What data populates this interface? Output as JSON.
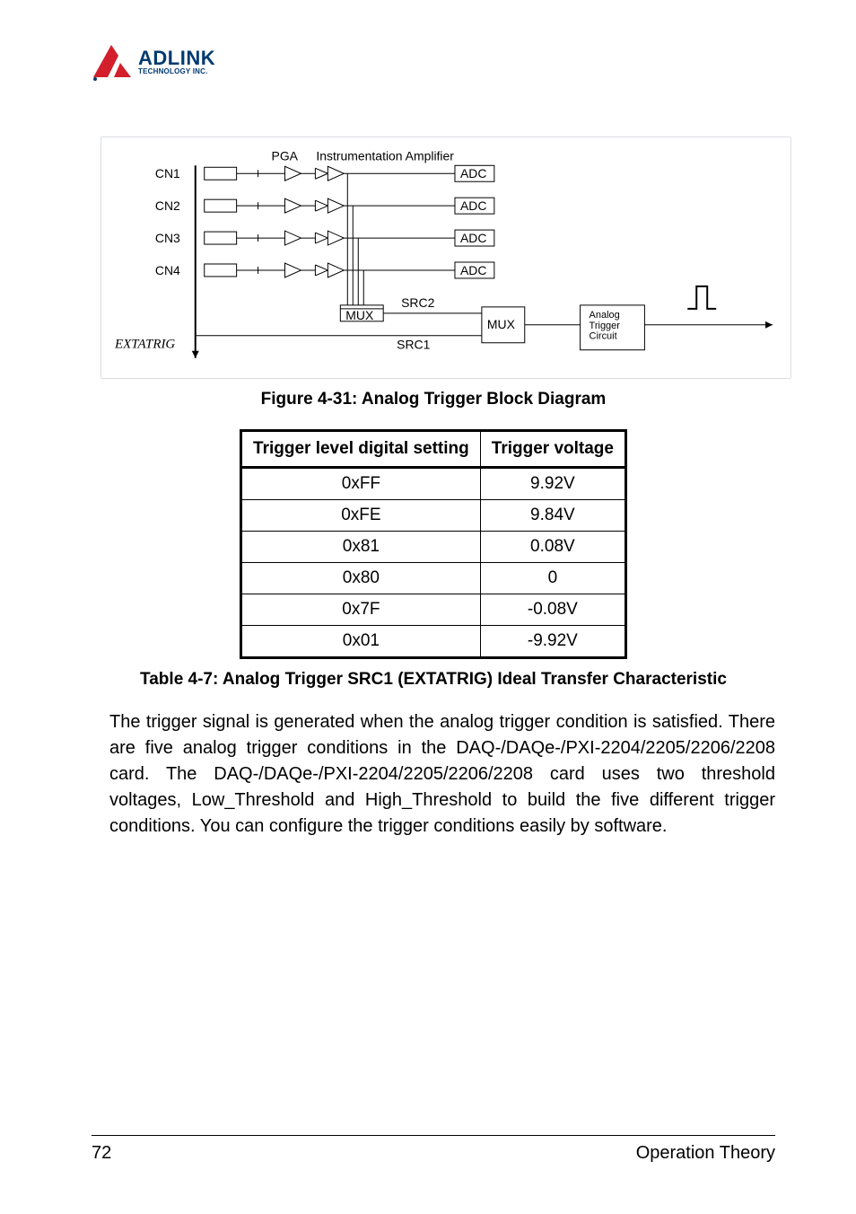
{
  "logo": {
    "brand": "ADLINK",
    "tagline": "TECHNOLOGY INC."
  },
  "diagram": {
    "labels": {
      "pga": "PGA",
      "instr_amp": "Instrumentation Amplifier",
      "cn1": "CN1",
      "cn2": "CN2",
      "cn3": "CN3",
      "cn4": "CN4",
      "adc": "ADC",
      "mux1": "MUX",
      "mux2": "MUX",
      "src1": "SRC1",
      "src2": "SRC2",
      "extatrig": "EXTATRIG",
      "analog_trigger": "Analog\nTrigger\nCircuit"
    }
  },
  "figure_caption": "Figure 4-31: Analog Trigger Block Diagram",
  "table": {
    "headers": [
      "Trigger level digital setting",
      "Trigger voltage"
    ],
    "rows": [
      [
        "0xFF",
        "9.92V"
      ],
      [
        "0xFE",
        "9.84V"
      ],
      [
        "0x81",
        "0.08V"
      ],
      [
        "0x80",
        "0"
      ],
      [
        "0x7F",
        "-0.08V"
      ],
      [
        "0x01",
        "-9.92V"
      ]
    ]
  },
  "table_caption": "Table  4-7: Analog Trigger SRC1 (EXTATRIG) Ideal Transfer Characteristic",
  "body_paragraph": "The trigger signal is generated when the analog trigger condition is satisfied. There are five analog trigger conditions in the DAQ-/DAQe-/PXI-2204/2205/2206/2208 card. The DAQ-/DAQe-/PXI-2204/2205/2206/2208 card uses two threshold voltages, Low_Threshold and High_Threshold to build the five different trigger conditions. You can configure the trigger conditions easily by software.",
  "footer": {
    "page": "72",
    "section": "Operation Theory"
  }
}
